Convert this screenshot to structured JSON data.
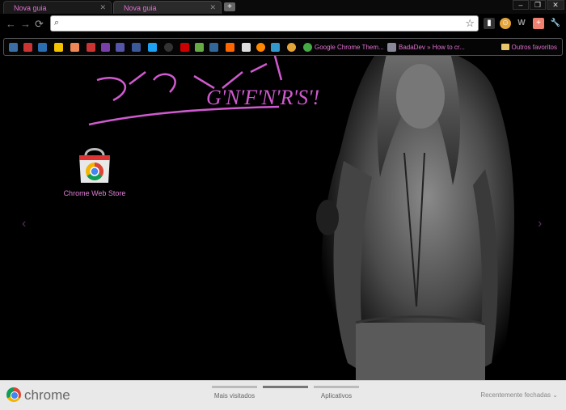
{
  "tabs": [
    {
      "label": "Nova guia",
      "active": true
    },
    {
      "label": "Nova guia",
      "active": false
    }
  ],
  "omnibox": {
    "value": "",
    "placeholder": ""
  },
  "bookmarks": [
    {
      "label": "Google Chrome Them..."
    },
    {
      "label": "BadaDev » How to cr..."
    }
  ],
  "other_bookmarks": "Outros favoritos",
  "artwork_text": "G'N'F'N'R'S'!",
  "apps": [
    {
      "label": "Chrome Web Store"
    }
  ],
  "footer": {
    "brand": "chrome",
    "sections": [
      "Mais visitados",
      "Aplicativos"
    ],
    "recent": "Recentemente fechadas"
  },
  "colors": {
    "accent": "#e070d0",
    "background": "#000000",
    "footer": "#e9e9e9"
  }
}
